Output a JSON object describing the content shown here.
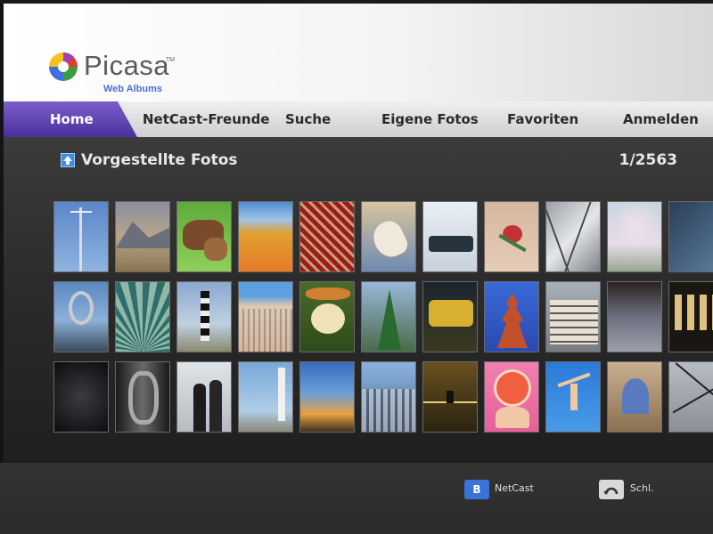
{
  "app": {
    "logo_text": "Picasa",
    "logo_tm": "TM",
    "logo_sub": "Web Albums"
  },
  "nav": {
    "items": [
      {
        "label": "Home",
        "active": true
      },
      {
        "label": "NetCast-Freunde",
        "active": false
      },
      {
        "label": "Suche",
        "active": false
      },
      {
        "label": "Eigene Fotos",
        "active": false
      },
      {
        "label": "Favoriten",
        "active": false
      },
      {
        "label": "Anmelden",
        "active": false
      }
    ]
  },
  "main": {
    "section_icon": "featured-photos-icon",
    "section_title": "Vorgestellte Fotos",
    "counter": "1/2563"
  },
  "footer": {
    "key_b": "B",
    "key_b_label": "NetCast",
    "back_icon": "back-icon",
    "back_label": "Schl."
  },
  "colors": {
    "accent_purple": "#5a3db0",
    "key_blue": "#3a72d8"
  }
}
